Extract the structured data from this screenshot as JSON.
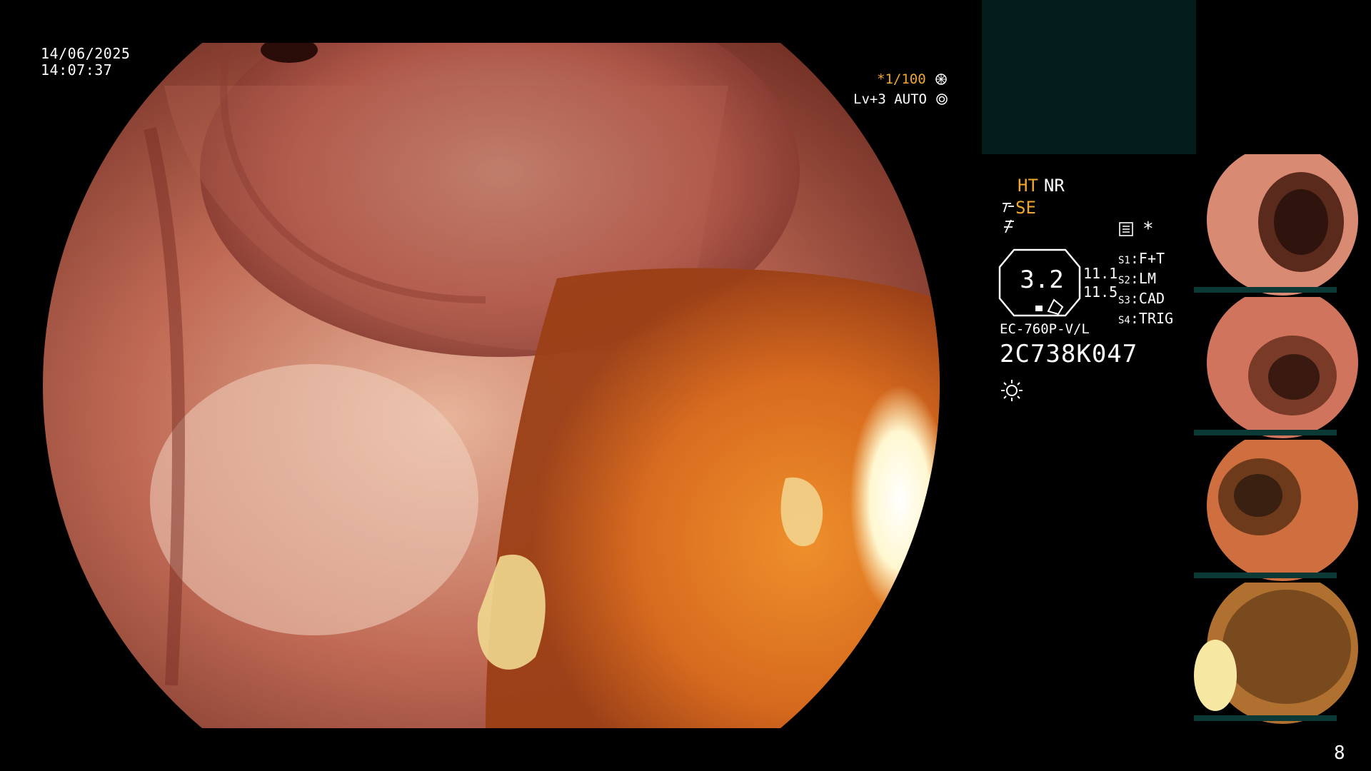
{
  "overlay": {
    "date": "14/06/2025",
    "time": "14:07:37",
    "shutter": "*1/100",
    "level": "Lv+3 AUTO"
  },
  "panel": {
    "ht": "HT",
    "nr": "NR",
    "se": "SE",
    "zoom": "3.2",
    "values": [
      "11.1",
      "11.5"
    ],
    "switches": [
      {
        "key": "S1",
        "label": "F+T"
      },
      {
        "key": "S2",
        "label": "LM"
      },
      {
        "key": "S3",
        "label": "CAD"
      },
      {
        "key": "S4",
        "label": "TRIG"
      }
    ],
    "model": "EC-760P-V/L",
    "serial": "2C738K047",
    "star": "*"
  },
  "thumbnails": [
    {
      "name": "captured-image-1"
    },
    {
      "name": "captured-image-2"
    },
    {
      "name": "captured-image-3"
    },
    {
      "name": "captured-image-4"
    }
  ],
  "page_number": "8",
  "colors": {
    "accent": "#f0a830",
    "panel": "#031b1b"
  },
  "icons": [
    "shutter-icon",
    "auto-icon",
    "memo-icon",
    "brightness-icon"
  ]
}
